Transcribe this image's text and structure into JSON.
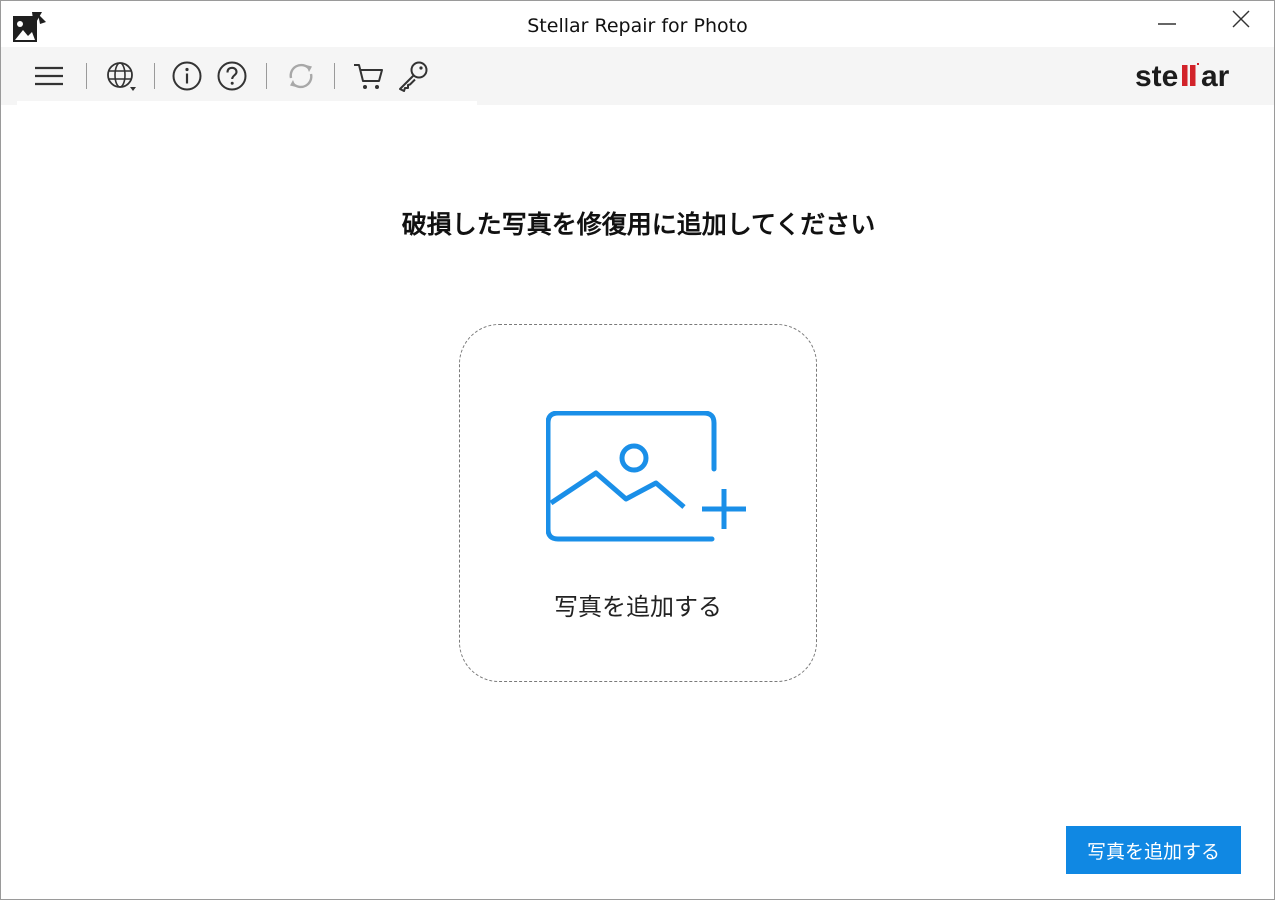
{
  "window": {
    "title": "Stellar Repair for Photo"
  },
  "toolbar": {
    "icons": [
      "menu-icon",
      "globe-icon",
      "info-icon",
      "help-icon",
      "refresh-icon",
      "cart-icon",
      "key-icon"
    ],
    "brand": "stellar"
  },
  "main": {
    "heading": "破損した写真を修復用に追加してください",
    "drop_zone_label": "写真を追加する",
    "add_button_label": "写真を追加する"
  },
  "colors": {
    "accent": "#1088e3",
    "icon_blue": "#1a8fe8",
    "brand_red": "#d2232a",
    "toolbar_bg": "#f5f5f5"
  }
}
